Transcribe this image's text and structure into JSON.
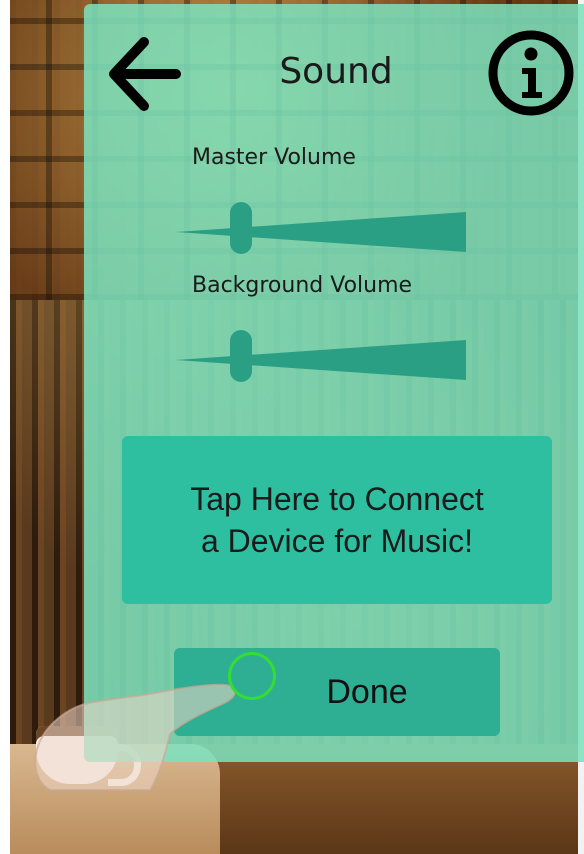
{
  "header": {
    "title": "Sound",
    "back_icon": "arrow-left-icon",
    "info_icon": "info-circle-icon"
  },
  "volumes": {
    "master_label": "Master Volume",
    "master_level": 0.2,
    "background_label": "Background Volume",
    "background_level": 0.2
  },
  "connect_button": {
    "label": "Tap Here to Connect\na Device for Music!"
  },
  "done_button": {
    "label": "Done"
  },
  "colors": {
    "panel": "#7ce2be",
    "button": "#2ebfa0",
    "slider": "#2a9f84",
    "tap_indicator": "#33dd33"
  }
}
